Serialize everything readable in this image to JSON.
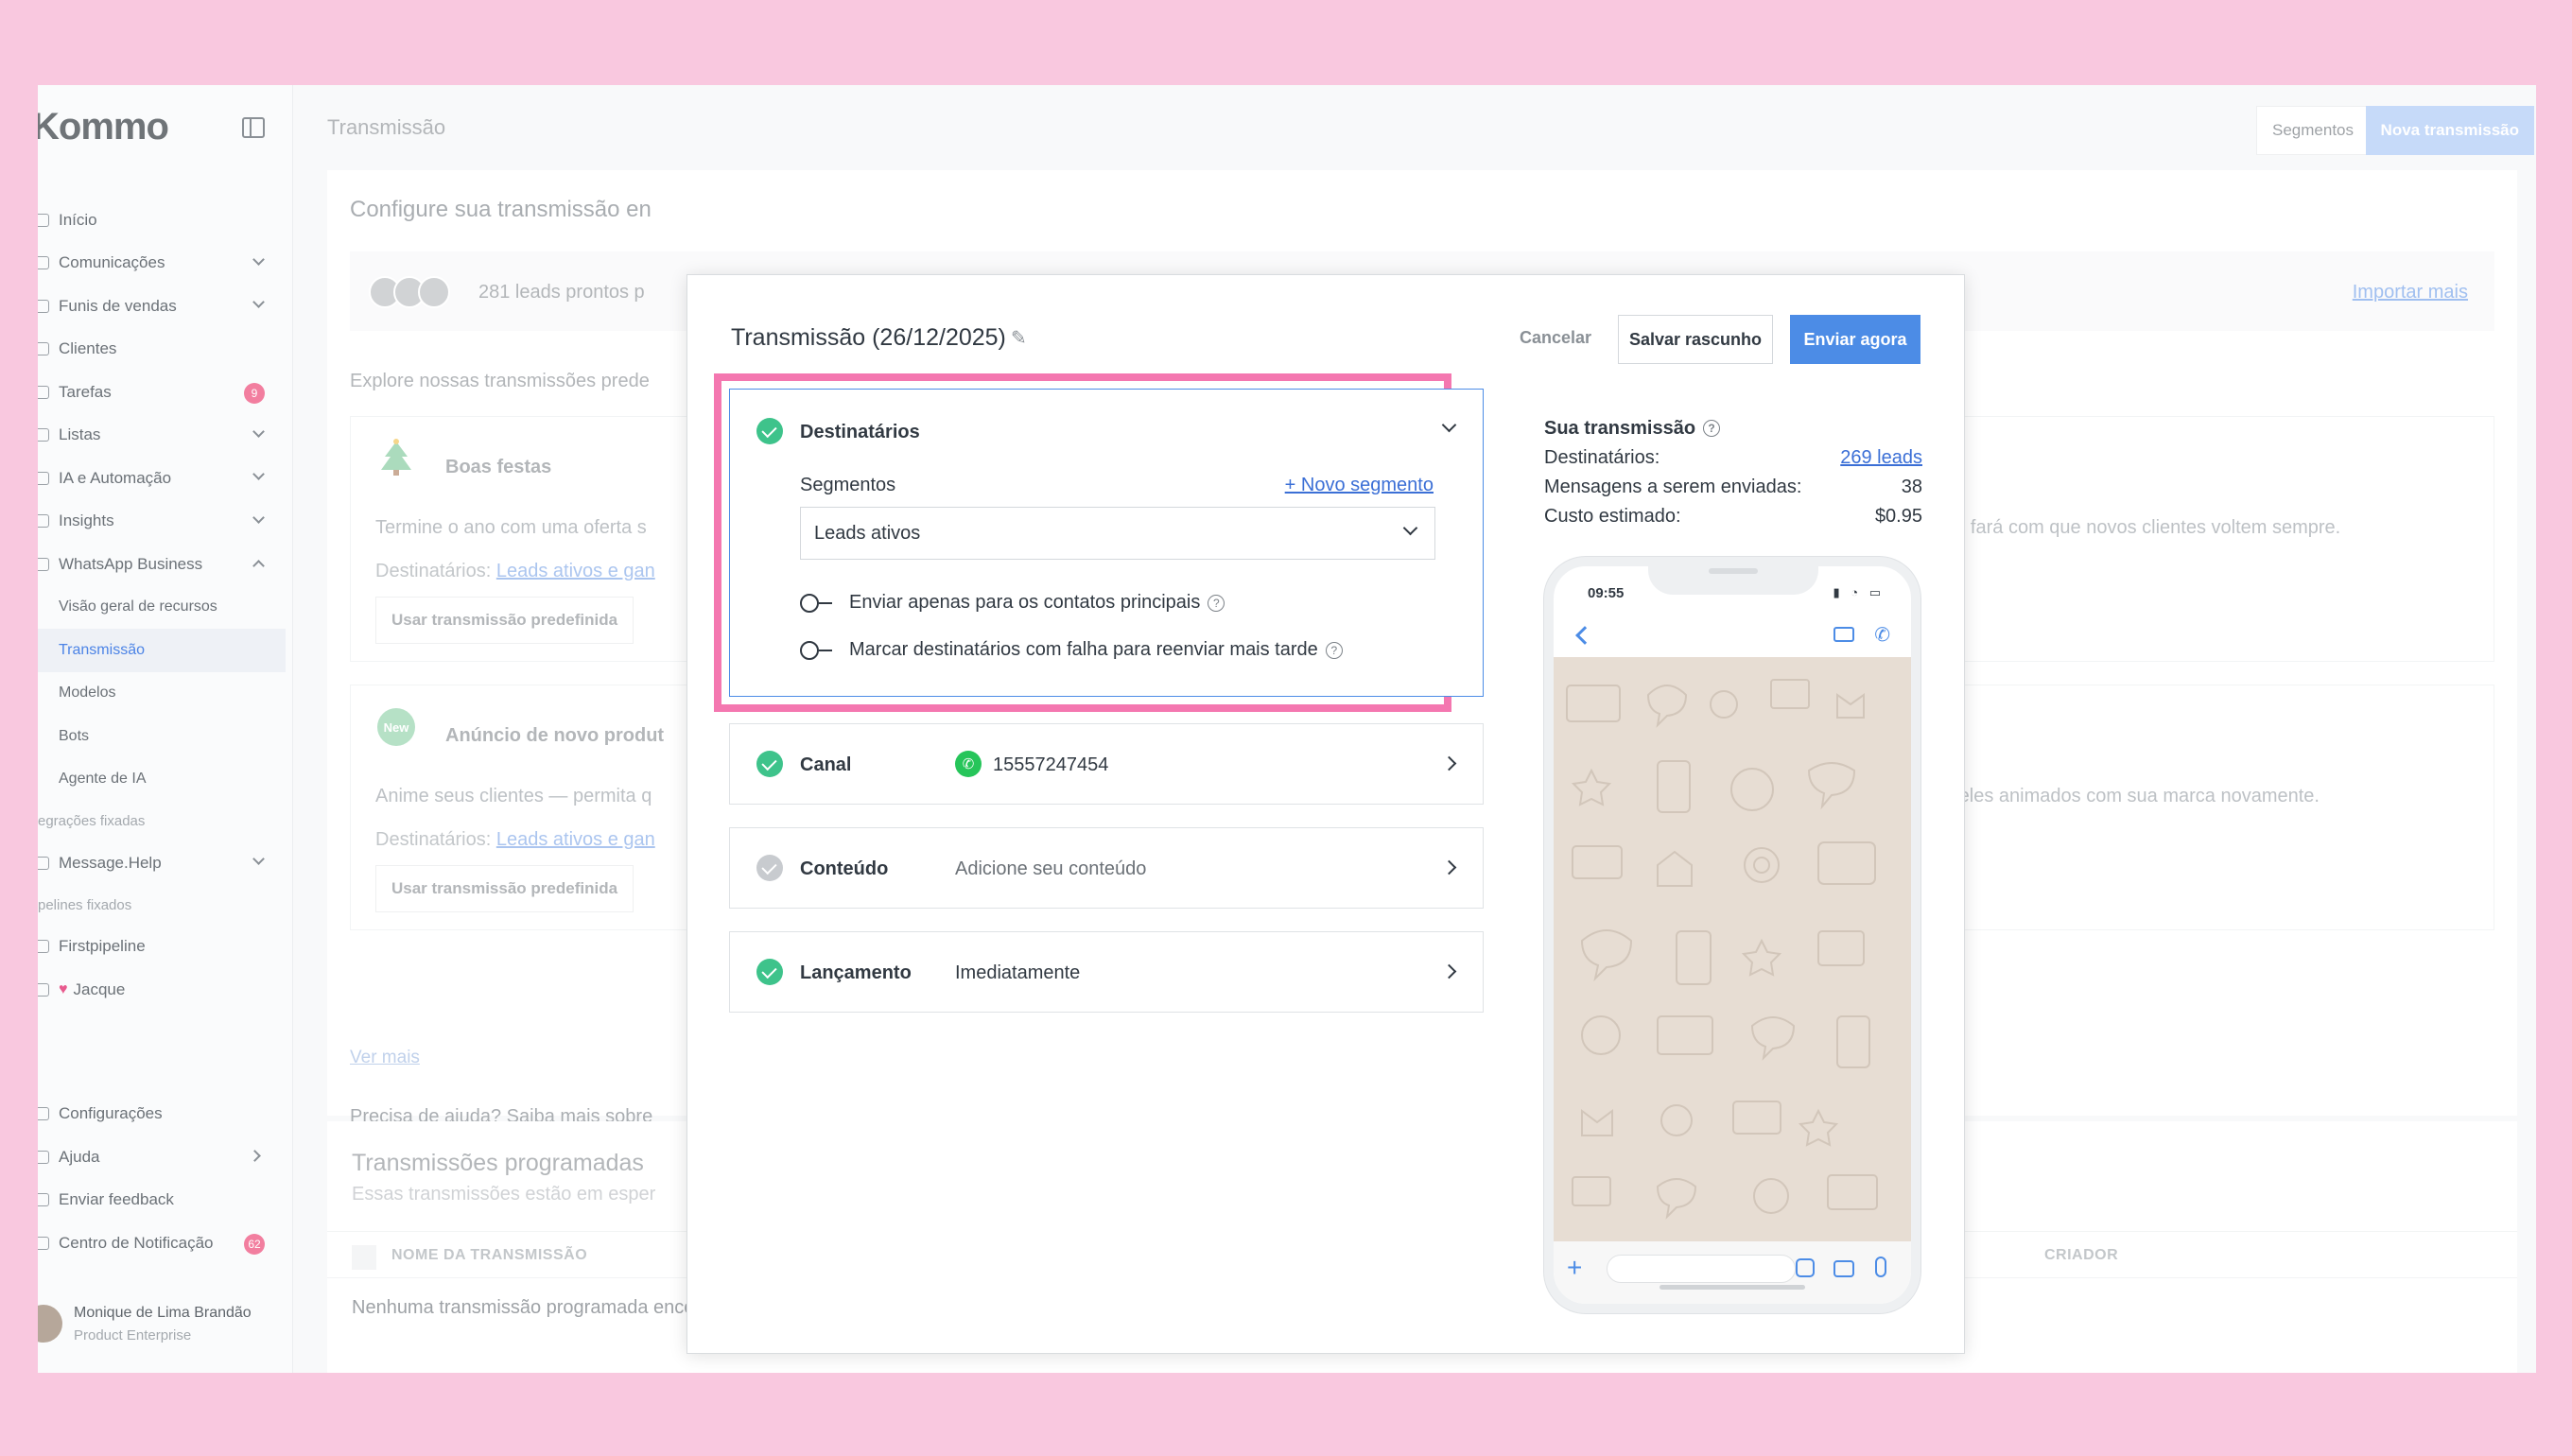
{
  "app": {
    "logo": "Kommo",
    "page_title": "Transmissão",
    "segments_button": "Segmentos",
    "new_button": "Nova transmissão"
  },
  "sidebar": {
    "items": [
      {
        "label": "Início"
      },
      {
        "label": "Comunicações"
      },
      {
        "label": "Funis de vendas"
      },
      {
        "label": "Clientes"
      },
      {
        "label": "Tarefas",
        "badge": "9"
      },
      {
        "label": "Listas"
      },
      {
        "label": "IA e Automação"
      },
      {
        "label": "Insights"
      },
      {
        "label": "WhatsApp Business"
      }
    ],
    "whatsapp_sub": [
      {
        "label": "Visão geral de recursos"
      },
      {
        "label": "Transmissão"
      },
      {
        "label": "Modelos"
      },
      {
        "label": "Bots"
      },
      {
        "label": "Agente de IA"
      }
    ],
    "section_integrations": "egrações fixadas",
    "message_help": "Message.Help",
    "section_pipelines": "pelines fixados",
    "pipeline_1": "Firstpipeline",
    "pipeline_2": "Jacque",
    "settings": "Configurações",
    "help": "Ajuda",
    "feedback": "Enviar feedback",
    "notifications": "Centro de Notificação",
    "notifications_badge": "62",
    "user_name": "Monique de Lima Brandão",
    "user_role": "Product Enterprise"
  },
  "background": {
    "configure_title": "Configure sua transmissão en",
    "leads_ready": "281 leads prontos p",
    "import_more": "Importar mais",
    "explore": "Explore nossas transmissões prede",
    "template1": {
      "name": "Boas festas",
      "desc": "Termine o ano com uma oferta s",
      "desc_right": "que fará com que novos clientes voltem sempre.",
      "dest_label": "Destinatários:",
      "dest_link": "Leads ativos e gan",
      "button": "Usar transmissão predefinida"
    },
    "template2": {
      "name": "Anúncio de novo produt",
      "desc": "Anime seus clientes — permita q",
      "desc_right": "xe eles animados com sua marca novamente.",
      "dest_label": "Destinatários:",
      "dest_link": "Leads ativos e gan",
      "button": "Usar transmissão predefinida"
    },
    "see_more": "Ver mais",
    "help_text": "Precisa de ajuda? Saiba mais sobre",
    "scheduled_title": "Transmissões programadas",
    "scheduled_sub": "Essas transmissões estão em esper",
    "col_name": "NOME DA TRANSMISSÃO",
    "col_creator": "CRIADOR",
    "empty": "Nenhuma transmissão programada encontrada"
  },
  "modal": {
    "title": "Transmissão (26/12/2025)",
    "cancel": "Cancelar",
    "save_draft": "Salvar rascunho",
    "send_now": "Enviar agora",
    "recipients": {
      "label": "Destinatários",
      "segments_label": "Segmentos",
      "new_segment": "+ Novo segmento",
      "selected_segment": "Leads ativos",
      "toggle1": "Enviar apenas para os contatos principais",
      "toggle2": "Marcar destinatários com falha para reenviar mais tarde"
    },
    "channel": {
      "label": "Canal",
      "value": "15557247454"
    },
    "content": {
      "label": "Conteúdo",
      "value": "Adicione seu conteúdo"
    },
    "launch": {
      "label": "Lançamento",
      "value": "Imediatamente"
    },
    "summary": {
      "title": "Sua transmissão",
      "recipients_label": "Destinatários:",
      "recipients_value": "269 leads",
      "messages_label": "Mensagens a serem enviadas:",
      "messages_value": "38",
      "cost_label": "Custo estimado:",
      "cost_value": "$0.95"
    },
    "phone": {
      "time": "09:55"
    }
  },
  "colors": {
    "accent": "#4c8ce6",
    "success": "#3ec38b",
    "highlight": "#f477b0",
    "page_background": "#f9c8df"
  }
}
